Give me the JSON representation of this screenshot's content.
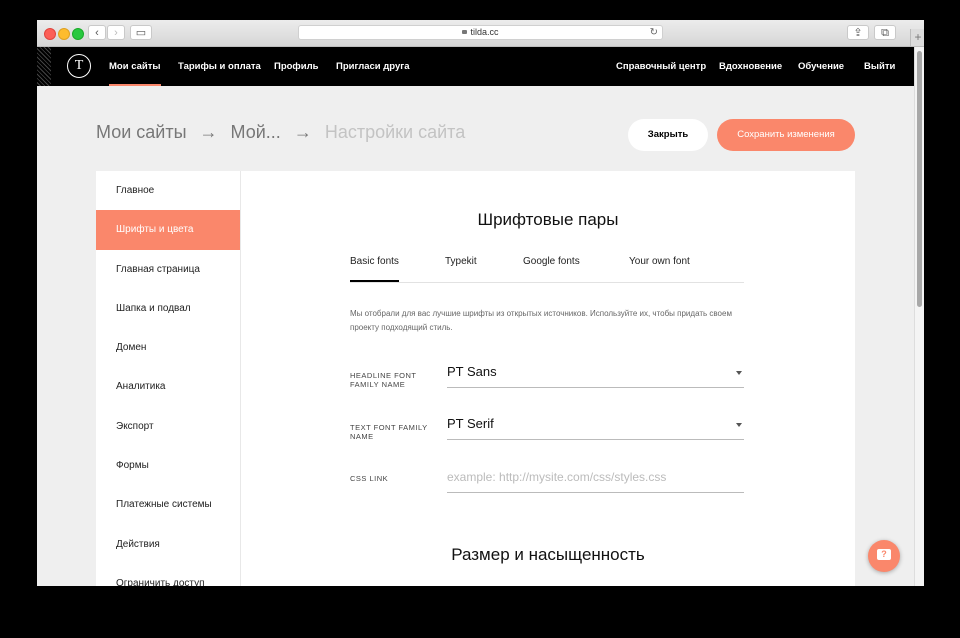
{
  "browser": {
    "url": "tilda.cc",
    "reload_icon": "reload-icon",
    "plus_label": "+"
  },
  "topnav": {
    "logo": "T",
    "left_items": [
      "Мои сайты",
      "Тарифы и оплата",
      "Профиль",
      "Пригласи друга"
    ],
    "right_items": [
      "Справочный центр",
      "Вдохновение",
      "Обучение",
      "Выйти"
    ]
  },
  "breadcrumb": {
    "items": [
      "Мои сайты",
      "→",
      "Мой...",
      "→"
    ],
    "current": "Настройки сайта"
  },
  "actions": {
    "close_label": "Закрыть",
    "save_label": "Сохранить изменения"
  },
  "sidebar": {
    "items": [
      "Главное",
      "Шрифты и цвета",
      "Главная страница",
      "Шапка и подвал",
      "Домен",
      "Аналитика",
      "Экспорт",
      "Формы",
      "Платежные системы",
      "Действия",
      "Ограничить доступ"
    ],
    "active": "Шрифты и цвета"
  },
  "main": {
    "title": "Шрифтовые пары",
    "tabs": [
      "Basic fonts",
      "Typekit",
      "Google fonts",
      "Your own font"
    ],
    "active_tab": "Basic fonts",
    "description": "Мы отобрали для вас лучшие шрифты из открытых источников. Используйте их, чтобы придать своем проекту подходящий стиль.",
    "fields": {
      "headline_label": "HEADLINE FONT FAMILY NAME",
      "headline_value": "PT Sans",
      "text_label": "TEXT FONT FAMILY NAME",
      "text_value": "PT Serif",
      "css_label": "CSS LINK",
      "css_placeholder": "example: http://mysite.com/css/styles.css"
    },
    "section2_title": "Размер и насыщенность"
  },
  "colors": {
    "accent": "#fa876b",
    "nav_bg": "#000000",
    "page_bg": "#efefef"
  }
}
